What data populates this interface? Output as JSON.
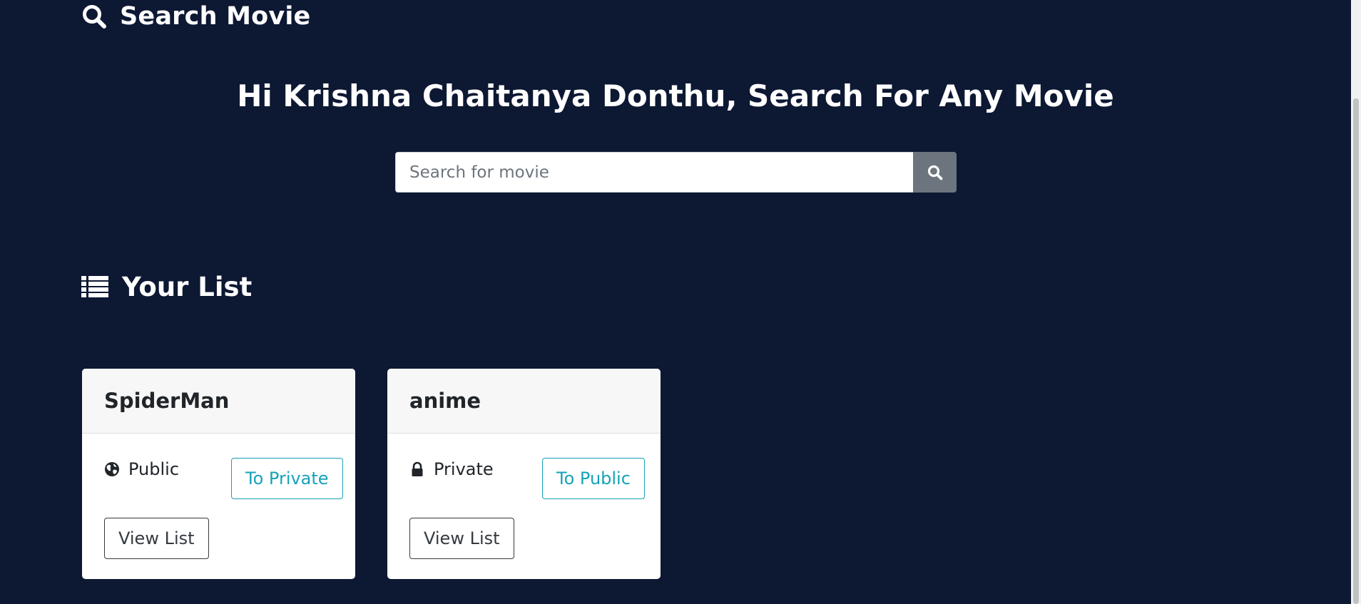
{
  "header": {
    "title": "Search Movie",
    "icon": "search-icon"
  },
  "greeting": "Hi Krishna Chaitanya Donthu, Search For Any Movie",
  "search": {
    "placeholder": "Search for movie",
    "value": "",
    "button_icon": "search-icon"
  },
  "list_section": {
    "title": "Your List",
    "icon": "list-icon"
  },
  "cards": [
    {
      "title": "SpiderMan",
      "visibility_icon": "globe-icon",
      "visibility_label": "Public",
      "toggle_label": "To Private",
      "view_label": "View List"
    },
    {
      "title": "anime",
      "visibility_icon": "lock-icon",
      "visibility_label": "Private",
      "toggle_label": "To Public",
      "view_label": "View List"
    }
  ],
  "colors": {
    "background": "#0d1833",
    "accent": "#17a2b8",
    "search_button": "#6c757d",
    "dark_button": "#343a40"
  }
}
